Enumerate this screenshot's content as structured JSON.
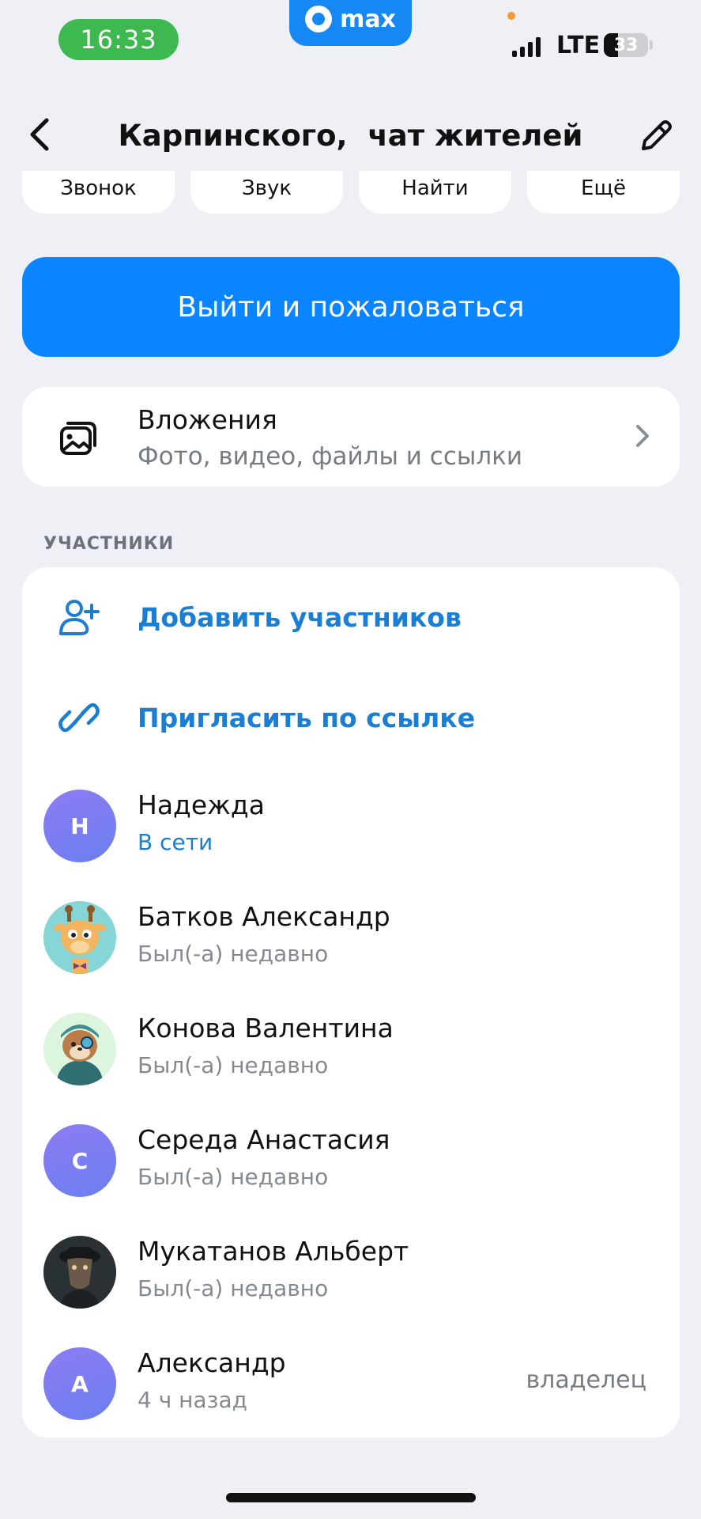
{
  "status_bar": {
    "time": "16:33",
    "app_name": "max",
    "network": "LTE",
    "battery": "33"
  },
  "header": {
    "title": "Карпинского,  чат жителей"
  },
  "actions": [
    {
      "label": "Звонок"
    },
    {
      "label": "Звук"
    },
    {
      "label": "Найти"
    },
    {
      "label": "Ещё"
    }
  ],
  "leave_button": "Выйти и пожаловаться",
  "attachments": {
    "title": "Вложения",
    "subtitle": "Фото, видео, файлы и ссылки"
  },
  "members_section": {
    "label": "УЧАСТНИКИ",
    "add_label": "Добавить участников",
    "invite_label": "Пригласить по ссылке",
    "members": [
      {
        "name": "Надежда",
        "status": "В сети",
        "avatar_letter": "Н",
        "online": true,
        "role": ""
      },
      {
        "name": "Батков Александр",
        "status": "Был(-а) недавно",
        "avatar_letter": "",
        "online": false,
        "role": ""
      },
      {
        "name": "Конова Валентина",
        "status": "Был(-а) недавно",
        "avatar_letter": "",
        "online": false,
        "role": ""
      },
      {
        "name": "Середа Анастасия",
        "status": "Был(-а) недавно",
        "avatar_letter": "С",
        "online": false,
        "role": ""
      },
      {
        "name": "Мукатанов Альберт",
        "status": "Был(-а) недавно",
        "avatar_letter": "",
        "online": false,
        "role": ""
      },
      {
        "name": "Александр",
        "status": "4 ч назад",
        "avatar_letter": "А",
        "online": false,
        "role": "владелец"
      }
    ]
  },
  "colors": {
    "accent": "#0a84ff",
    "link": "#1a7fd4",
    "background": "#eef0f5",
    "time_pill": "#3db94f"
  }
}
